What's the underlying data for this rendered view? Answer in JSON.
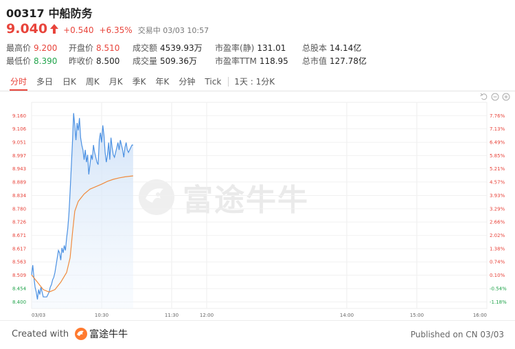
{
  "stock": {
    "code": "00317",
    "name": "中船防务",
    "price": "9.040",
    "change": "+0.540",
    "change_pct": "+6.35%",
    "status": "交易中 03/03 10:57"
  },
  "stats": {
    "high_label": "最高价",
    "high": "9.200",
    "low_label": "最低价",
    "low": "8.390",
    "open_label": "开盘价",
    "open": "8.510",
    "prev_close_label": "昨收价",
    "prev_close": "8.500",
    "turnover_label": "成交额",
    "turnover": "4539.93万",
    "volume_label": "成交量",
    "volume": "509.36万",
    "pe_static_label": "市盈率(静)",
    "pe_static": "131.01",
    "pe_ttm_label": "市盈率TTM",
    "pe_ttm": "118.95",
    "total_shares_label": "总股本",
    "total_shares": "14.14亿",
    "market_cap_label": "总市值",
    "market_cap": "127.78亿"
  },
  "tabs": [
    {
      "label": "分时",
      "active": true
    },
    {
      "label": "多日"
    },
    {
      "label": "日K"
    },
    {
      "label": "周K"
    },
    {
      "label": "月K"
    },
    {
      "label": "季K"
    },
    {
      "label": "年K"
    },
    {
      "label": "分钟"
    },
    {
      "label": "Tick"
    }
  ],
  "interval_label": "1天 : 1分K",
  "watermark_text": "富途牛牛",
  "footer": {
    "created_with": "Created with",
    "brand": "富途牛牛",
    "published": "Published on CN 03/03"
  },
  "colors": {
    "up": "#e8443b",
    "down": "#20a34a",
    "price_line": "#4a90e2",
    "avg_line": "#f08a3c",
    "area_fill": "#d6e6f8"
  },
  "icons": [
    "up-arrow-icon",
    "reset-icon",
    "zoom-out-icon",
    "zoom-in-icon",
    "futu-logo-icon"
  ],
  "chart_data": {
    "type": "line",
    "x_tick_labels": [
      "03/03",
      "10:30",
      "11:30",
      "12:00",
      "14:00",
      "15:00",
      "16:00"
    ],
    "x_tick_minutes": [
      0,
      60,
      120,
      150,
      270,
      330,
      390
    ],
    "y_tick_labels": [
      "9.160",
      "9.106",
      "9.051",
      "8.997",
      "8.943",
      "8.889",
      "8.834",
      "8.780",
      "8.726",
      "8.671",
      "8.617",
      "8.563",
      "8.509",
      "8.454",
      "8.400"
    ],
    "pct_tick_labels": [
      "7.76%",
      "7.13%",
      "6.49%",
      "5.85%",
      "5.21%",
      "4.57%",
      "3.93%",
      "3.29%",
      "2.66%",
      "2.02%",
      "1.38%",
      "0.74%",
      "0.10%",
      "-0.54%",
      "-1.18%"
    ],
    "ylim": [
      8.373,
      9.214
    ],
    "series": [
      {
        "x": [
          0,
          1,
          2,
          3,
          4,
          5,
          6,
          7,
          8,
          9,
          10,
          11,
          12,
          13,
          14,
          15,
          16,
          17,
          18,
          19,
          20,
          21,
          22,
          23,
          24,
          25,
          26,
          27,
          28,
          29,
          30,
          31,
          32,
          33,
          34,
          35,
          36,
          37,
          38,
          39,
          40,
          41,
          42,
          43,
          44,
          45,
          46,
          47,
          48,
          49,
          50,
          51,
          52,
          53,
          54,
          55,
          56,
          57,
          58,
          59,
          60,
          61,
          62,
          63,
          64,
          65,
          66,
          67,
          68,
          69,
          70,
          71,
          72,
          73,
          74,
          75,
          76,
          77,
          78,
          79,
          80,
          81,
          82,
          83,
          84,
          85,
          86,
          87
        ],
        "values": [
          8.51,
          8.55,
          8.5,
          8.46,
          8.44,
          8.41,
          8.45,
          8.43,
          8.46,
          8.44,
          8.42,
          8.42,
          8.42,
          8.42,
          8.43,
          8.44,
          8.46,
          8.47,
          8.49,
          8.5,
          8.52,
          8.55,
          8.58,
          8.61,
          8.6,
          8.57,
          8.62,
          8.6,
          8.63,
          8.61,
          8.66,
          8.7,
          8.76,
          8.85,
          8.95,
          9.05,
          9.17,
          9.12,
          9.06,
          9.13,
          9.1,
          9.15,
          9.07,
          9.04,
          9.02,
          8.98,
          9.02,
          8.97,
          9.0,
          8.92,
          8.96,
          9.0,
          8.98,
          9.04,
          9.01,
          8.99,
          8.97,
          8.96,
          9.06,
          9.09,
          9.05,
          9.12,
          9.08,
          9.01,
          8.97,
          9.0,
          9.05,
          8.98,
          9.07,
          9.03,
          9.0,
          8.99,
          9.01,
          9.03,
          9.05,
          9.02,
          9.06,
          9.04,
          9.02,
          8.99,
          9.03,
          9.05,
          9.02,
          9.01,
          9.02,
          9.03,
          9.04,
          9.04
        ]
      },
      {
        "x": [
          0,
          5,
          10,
          15,
          20,
          25,
          30,
          33,
          35,
          37,
          40,
          45,
          50,
          55,
          60,
          65,
          70,
          75,
          80,
          87
        ],
        "values": [
          8.51,
          8.48,
          8.45,
          8.44,
          8.45,
          8.48,
          8.52,
          8.58,
          8.68,
          8.77,
          8.81,
          8.84,
          8.86,
          8.87,
          8.88,
          8.892,
          8.9,
          8.906,
          8.91,
          8.914
        ]
      }
    ]
  }
}
